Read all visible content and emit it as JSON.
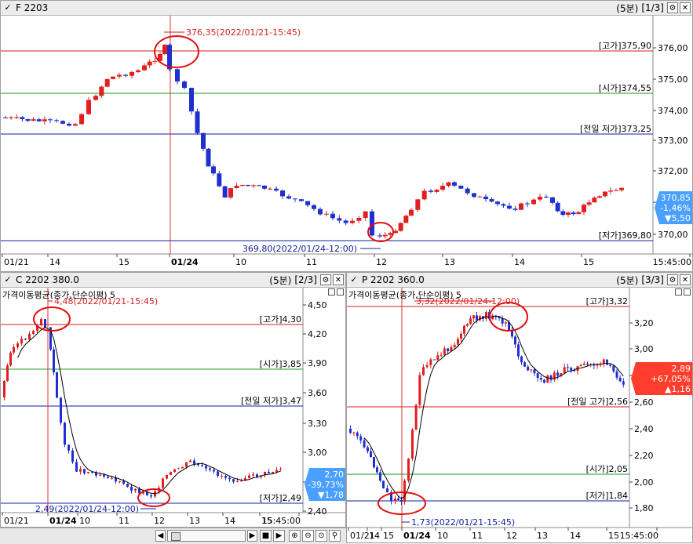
{
  "colors": {
    "up": "#e02020",
    "down": "#2030d0",
    "hi_line": "#d02020",
    "open_line": "#1a9a1a",
    "prev_line": "#1020a0",
    "low_line": "#1020a0",
    "circle": "#e01010",
    "cursor": "#e03030",
    "badge_down": "#4aa0ff",
    "badge_up": "#ff3d2d"
  },
  "panel1": {
    "title": "F 2203",
    "interval": "(5분)",
    "page": "[1/3]",
    "y_ticks": [
      "376,00",
      "375,00",
      "374,00",
      "373,00",
      "372,00",
      "371,00",
      "370,00"
    ],
    "x_ticks": [
      "01/21",
      "14",
      "15",
      "01/24",
      "10",
      "11",
      "12",
      "13",
      "14",
      "15",
      "15:45:00"
    ],
    "ref_labels": {
      "high": "[고가]375,90",
      "open": "[시가]374,55",
      "prev_low": "[전일 저가]373,25",
      "low": "[저가]369,80"
    },
    "peak_annot": "376,35(2022/01/21-15:45)",
    "low_annot": "369,80(2022/01/24-12:00)",
    "badge": {
      "price": "370,85",
      "pct": "-1,46%",
      "chg": "▼5,50"
    }
  },
  "panel2": {
    "title": "C 2202 380.0",
    "interval": "(5분)",
    "page": "[2/3]",
    "ma_label": "가격이동평균(종가,단순이평) 5",
    "y_ticks": [
      "4,50",
      "4,20",
      "3,90",
      "3,60",
      "3,30",
      "3,00",
      "2,70",
      "2,40"
    ],
    "x_ticks": [
      "01/21",
      "01/24",
      "10",
      "11",
      "12",
      "13",
      "14",
      "15",
      "15:45:00"
    ],
    "ref_labels": {
      "high": "[고가]4,30",
      "open": "[시가]3,85",
      "prev_low": "[전일 저가]3,47",
      "low": "[저가]2,49"
    },
    "peak_annot": "4,48(2022/01/21-15:45)",
    "low_annot": "2,49(2022/01/24-12:00)",
    "badge": {
      "price": "2,70",
      "pct": "-39,73%",
      "chg": "▼1,78"
    }
  },
  "panel3": {
    "title": "P 2202 360.0",
    "interval": "(5분)",
    "page": "[3/3]",
    "ma_label": "가격이동평균(종가,단순이평) 5",
    "y_ticks": [
      "3,20",
      "3,00",
      "2,80",
      "2,60",
      "2,40",
      "2,20",
      "2,00",
      "1,80"
    ],
    "x_ticks": [
      "01/21",
      "14",
      "15",
      "01/24",
      "10",
      "11",
      "12",
      "13",
      "14",
      "15",
      "15:45:00"
    ],
    "ref_labels": {
      "high": "[고가]3,32",
      "prev_high": "[전일 고가]2,56",
      "open": "[시가]2,05",
      "low": "[저가]1,84"
    },
    "peak_annot": "3,32(2022/01/24-12:00)",
    "low_annot": "1,73(2022/01/21-15:45)",
    "badge": {
      "price": "2,89",
      "pct": "+67,05%",
      "chg": "▲1,16"
    }
  },
  "toolbar": {
    "icons": [
      "scroll-left-icon",
      "scroll-right-icon",
      "play-back-icon",
      "stop-icon",
      "play-forward-icon",
      "zoom-in-icon",
      "zoom-out-icon",
      "zoom-reset-icon",
      "zoom-fit-icon",
      "search-icon"
    ]
  }
}
